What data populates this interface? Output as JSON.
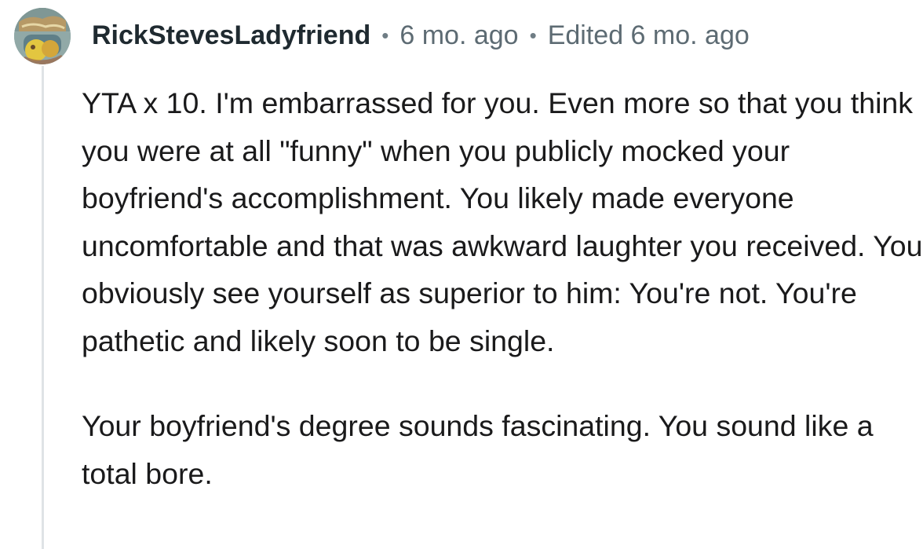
{
  "comment": {
    "avatar_icon": "user-avatar-image",
    "username": "RickStevesLadyfriend",
    "separator": "•",
    "time_ago": "6 mo. ago",
    "edited": "Edited 6 mo. ago",
    "paragraphs": [
      "YTA x 10. I'm embarrassed for you. Even more so that you think you were at all \"funny\" when you publicly mocked your boyfriend's accomplishment. You likely made everyone uncomfortable and that was awkward laughter you received. You obviously see yourself as superior to him: You're not. You're pathetic and likely soon to be single.",
      "Your boyfriend's degree sounds fascinating. You sound like a total bore."
    ]
  },
  "colors": {
    "username": "#1f2a30",
    "meta": "#5d6b73",
    "body": "#1a1a1b",
    "thread_line": "#dfe3e6"
  }
}
